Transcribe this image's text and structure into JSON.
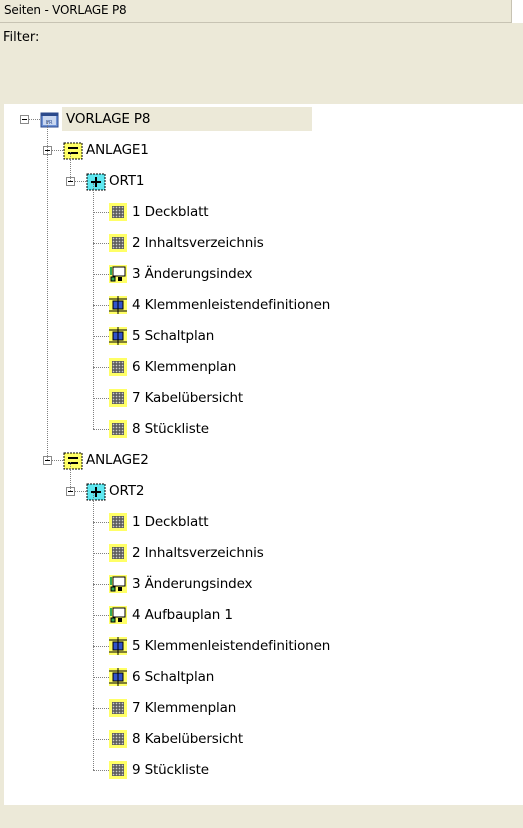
{
  "window": {
    "title": "Seiten - VORLAGE P8"
  },
  "filter": {
    "label": "Filter:",
    "value": ""
  },
  "tree": {
    "root": "VORLAGE P8",
    "anlagen": [
      {
        "label": "ANLAGE1",
        "orte": [
          {
            "label": "ORT1",
            "pages": [
              {
                "label": "1 Deckblatt",
                "icon": "grid-icon"
              },
              {
                "label": "2 Inhaltsverzeichnis",
                "icon": "grid-icon"
              },
              {
                "label": "3 Änderungsindex",
                "icon": "installation-icon"
              },
              {
                "label": "4 Klemmenleistendefinitionen",
                "icon": "schematic-icon"
              },
              {
                "label": "5 Schaltplan",
                "icon": "schematic-icon"
              },
              {
                "label": "6 Klemmenplan",
                "icon": "grid-icon"
              },
              {
                "label": "7 Kabelübersicht",
                "icon": "grid-icon"
              },
              {
                "label": "8 Stückliste",
                "icon": "grid-icon"
              }
            ]
          }
        ]
      },
      {
        "label": "ANLAGE2",
        "orte": [
          {
            "label": "ORT2",
            "pages": [
              {
                "label": "1 Deckblatt",
                "icon": "grid-icon"
              },
              {
                "label": "2 Inhaltsverzeichnis",
                "icon": "grid-icon"
              },
              {
                "label": "3 Änderungsindex",
                "icon": "installation-icon"
              },
              {
                "label": "4 Aufbauplan 1",
                "icon": "installation-icon"
              },
              {
                "label": "5 Klemmenleistendefinitionen",
                "icon": "schematic-icon"
              },
              {
                "label": "6 Schaltplan",
                "icon": "schematic-icon"
              },
              {
                "label": "7 Klemmenplan",
                "icon": "grid-icon"
              },
              {
                "label": "8 Kabelübersicht",
                "icon": "grid-icon"
              },
              {
                "label": "9 Stückliste",
                "icon": "grid-icon"
              }
            ]
          }
        ]
      }
    ]
  },
  "colors": {
    "panel": "#ece9d8",
    "icon_yellow": "#ffff66",
    "icon_cyan": "#5ee7f0",
    "icon_blue": "#3355cc",
    "icon_green": "#33aa55"
  }
}
